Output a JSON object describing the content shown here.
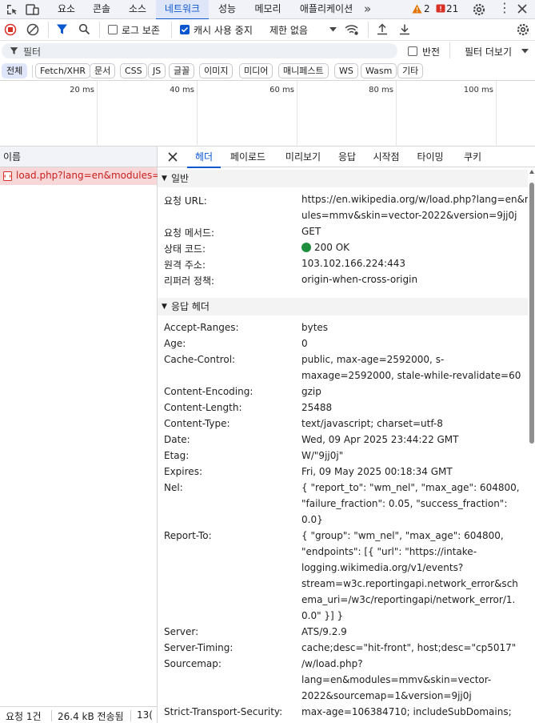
{
  "top_tabs": [
    "요소",
    "콘솔",
    "소스",
    "네트워크",
    "성능",
    "메모리",
    "애플리케이션"
  ],
  "top_tabs_active": "네트워크",
  "warnings_count": "2",
  "errors_count": "21",
  "toolbar": {
    "preserve_log_label": "로그 보존",
    "disable_cache_label": "캐시 사용 중지",
    "throttle_value": "제한 없음"
  },
  "filter": {
    "placeholder": "필터",
    "invert_label": "반전",
    "more_filters_label": "필터 더보기"
  },
  "type_filters": [
    "전체",
    "Fetch/XHR",
    "문서",
    "CSS",
    "JS",
    "글꼴",
    "이미지",
    "미디어",
    "매니페스트",
    "WS",
    "Wasm",
    "기타"
  ],
  "timeline_ticks": [
    "20 ms",
    "40 ms",
    "60 ms",
    "80 ms",
    "100 ms"
  ],
  "request_list": {
    "column_name": "이름",
    "rows": [
      "load.php?lang=en&modules=..."
    ]
  },
  "status_bar": {
    "requests": "요청 1건",
    "transferred": "26.4 kB 전송됨",
    "resources": "13("
  },
  "detail_tabs": [
    "헤더",
    "페이로드",
    "미리보기",
    "응답",
    "시작점",
    "타이밍",
    "쿠키"
  ],
  "detail_tabs_active": "헤더",
  "general": {
    "title": "일반",
    "rows": [
      {
        "k": "요청 URL:",
        "v": [
          "https://en.wikipedia.org/w/load.php?lang=en&mod",
          "ules=mmv&skin=vector-2022&version=9jj0j"
        ]
      },
      {
        "k": "요청 메서드:",
        "v": [
          "GET"
        ]
      },
      {
        "k": "상태 코드:",
        "v": [
          "200 OK"
        ]
      },
      {
        "k": "원격 주소:",
        "v": [
          "103.102.166.224:443"
        ]
      },
      {
        "k": "리퍼러 정책:",
        "v": [
          "origin-when-cross-origin"
        ]
      }
    ]
  },
  "response_headers": {
    "title": "응답 헤더",
    "rows": [
      {
        "k": "Accept-Ranges:",
        "v": [
          "bytes"
        ]
      },
      {
        "k": "Age:",
        "v": [
          "0"
        ]
      },
      {
        "k": "Cache-Control:",
        "v": [
          "public, max-age=2592000, s-",
          "maxage=2592000, stale-while-revalidate=60"
        ]
      },
      {
        "k": "Content-Encoding:",
        "v": [
          "gzip"
        ]
      },
      {
        "k": "Content-Length:",
        "v": [
          "25488"
        ]
      },
      {
        "k": "Content-Type:",
        "v": [
          "text/javascript; charset=utf-8"
        ]
      },
      {
        "k": "Date:",
        "v": [
          "Wed, 09 Apr 2025 23:44:22 GMT"
        ]
      },
      {
        "k": "Etag:",
        "v": [
          "W/\"9jj0j\""
        ]
      },
      {
        "k": "Expires:",
        "v": [
          "Fri, 09 May 2025 00:18:34 GMT"
        ]
      },
      {
        "k": "Nel:",
        "v": [
          "{ \"report_to\": \"wm_nel\", \"max_age\": 604800,",
          "\"failure_fraction\": 0.05, \"success_fraction\":",
          "0.0}"
        ]
      },
      {
        "k": "Report-To:",
        "v": [
          "{ \"group\": \"wm_nel\", \"max_age\": 604800,",
          "\"endpoints\": [{ \"url\": \"https://intake-",
          "logging.wikimedia.org/v1/events?",
          "stream=w3c.reportingapi.network_error&sch",
          "ema_uri=/w3c/reportingapi/network_error/1.",
          "0.0\" }] }"
        ]
      },
      {
        "k": "Server:",
        "v": [
          "ATS/9.2.9"
        ]
      },
      {
        "k": "Server-Timing:",
        "v": [
          "cache;desc=\"hit-front\", host;desc=\"cp5017\""
        ]
      },
      {
        "k": "Sourcemap:",
        "v": [
          "/w/load.php?",
          "lang=en&modules=mmv&skin=vector-",
          "2022&sourcemap=1&version=9jj0j"
        ]
      },
      {
        "k": "Strict-Transport-Security:",
        "v": [
          "max-age=106384710; includeSubDomains;"
        ]
      }
    ]
  },
  "colors": {
    "accent": "#0b57d0",
    "status_ok": "#1e8e3e",
    "record": "#d93025",
    "selected_row": "#f8d7d9",
    "warning": "#e37400"
  }
}
